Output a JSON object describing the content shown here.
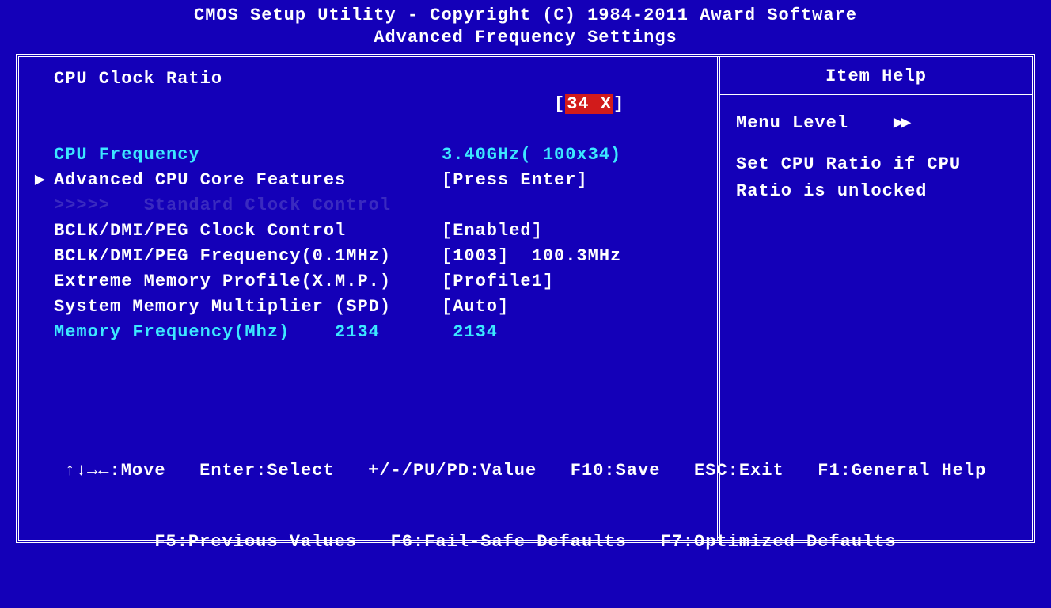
{
  "header": {
    "title": "CMOS Setup Utility - Copyright (C) 1984-2011 Award Software",
    "subtitle": "Advanced Frequency Settings"
  },
  "settings": {
    "cpu_clock_ratio": {
      "label": "CPU Clock Ratio",
      "lbr": "[",
      "val": "34 X",
      "rbr": "]"
    },
    "cpu_frequency": {
      "label": "CPU Frequency",
      "val": "3.40GHz( 100x34)"
    },
    "advanced_cpu": {
      "label": "Advanced CPU Core Features",
      "val": "[Press Enter]"
    },
    "std_clock_hdr": {
      "label": ">>>>>   Standard Clock Control"
    },
    "bclk_clock_ctrl": {
      "label": "BCLK/DMI/PEG Clock Control",
      "val": "[Enabled]"
    },
    "bclk_freq": {
      "label": "BCLK/DMI/PEG Frequency(0.1MHz)",
      "val": "[1003]  100.3MHz"
    },
    "xmp": {
      "label": "Extreme Memory Profile(X.M.P.)",
      "val": "[Profile1]"
    },
    "mem_mult": {
      "label": "System Memory Multiplier (SPD)",
      "val": "[Auto]"
    },
    "mem_freq": {
      "label": "Memory Frequency(Mhz)    2134",
      "val": " 2134"
    }
  },
  "help": {
    "title": "Item Help",
    "menu_level_label": "Menu Level",
    "chevron": "▶▶",
    "text1": "Set CPU Ratio if CPU",
    "text2": "Ratio is unlocked"
  },
  "footer": {
    "line1": "↑↓→←:Move   Enter:Select   +/-/PU/PD:Value   F10:Save   ESC:Exit   F1:General Help",
    "line2": "F5:Previous Values   F6:Fail-Safe Defaults   F7:Optimized Defaults"
  }
}
